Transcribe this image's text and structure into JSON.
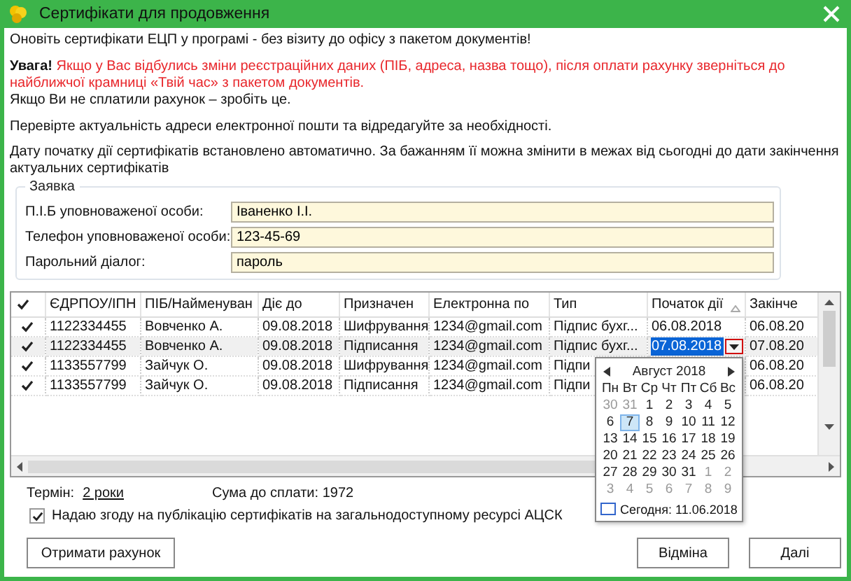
{
  "window": {
    "title": "Сертифікати для продовження"
  },
  "intro": "Оновіть сертифікати ЕЦП у програмі - без візиту до офісу з пакетом документів!",
  "warning": {
    "label": "Увага!",
    "text": "Якщо у Вас відбулись зміни реєстраційних даних (ПІБ, адреса, назва тощо), після оплати рахунку зверніться до найближчої крамниці «Твій час» з пакетом документів."
  },
  "note_unpaid": "Якщо Ви не сплатили рахунок – зробіть це.",
  "note_email": "Перевірте актуальність адреси електронної пошти та відредагуйте за необхідності.",
  "note_date": "Дату початку дії сертифікатів встановлено автоматично. За бажанням її можна змінити в межах від сьогодні до дати закінчення актуальних сертифікатів",
  "form": {
    "title": "Заявка",
    "fields": [
      {
        "label": "П.І.Б уповноваженої особи:",
        "value": "Іваненко І.І."
      },
      {
        "label": "Телефон уповноваженої особи:",
        "value": "123-45-69"
      },
      {
        "label": "Парольний діалог:",
        "value": "пароль"
      }
    ]
  },
  "table": {
    "all_checked": true,
    "columns": [
      {
        "label": "ЄДРПОУ/ІПН",
        "kind": "text",
        "sorted": false
      },
      {
        "label": "ПІБ/Найменуван",
        "kind": "text",
        "sorted": false
      },
      {
        "label": "Діє до",
        "kind": "text",
        "sorted": false
      },
      {
        "label": "Призначен",
        "kind": "text",
        "sorted": false
      },
      {
        "label": "Електронна по",
        "kind": "text",
        "sorted": false
      },
      {
        "label": "Тип",
        "kind": "text",
        "sorted": false
      },
      {
        "label": "Початок дії",
        "kind": "date_picker",
        "sorted": true
      },
      {
        "label": "Закінче",
        "kind": "text",
        "sorted": false
      }
    ],
    "rows": [
      {
        "checked": true,
        "selected": false,
        "cells": [
          "1122334455",
          "Вовченко А.",
          "09.08.2018",
          "Шифрування",
          "1234@gmail.com",
          "Підпис бухг...",
          "06.08.2018",
          "06.08.20"
        ]
      },
      {
        "checked": true,
        "selected": true,
        "cells": [
          "1122334455",
          "Вовченко А.",
          "09.08.2018",
          "Підписання",
          "1234@gmail.com",
          "Підпис бухг...",
          "07.08.2018",
          "07.08.20"
        ]
      },
      {
        "checked": true,
        "selected": false,
        "cells": [
          "1133557799",
          "Зайчук О.",
          "09.08.2018",
          "Шифрування",
          "1234@gmail.com",
          "Підпи",
          null,
          "06.08.20"
        ]
      },
      {
        "checked": true,
        "selected": false,
        "cells": [
          "1133557799",
          "Зайчук О.",
          "09.08.2018",
          "Підписання",
          "1234@gmail.com",
          "Підпи",
          null,
          "06.08.20"
        ]
      }
    ]
  },
  "calendar": {
    "month": "Август 2018",
    "weekdays": [
      "Пн",
      "Вт",
      "Ср",
      "Чт",
      "Пт",
      "Сб",
      "Вс"
    ],
    "weeks": [
      [
        {
          "day": "30",
          "other_month": true,
          "selected": false
        },
        {
          "day": "31",
          "other_month": true,
          "selected": false
        },
        {
          "day": "1",
          "other_month": false,
          "selected": false
        },
        {
          "day": "2",
          "other_month": false,
          "selected": false
        },
        {
          "day": "3",
          "other_month": false,
          "selected": false
        },
        {
          "day": "4",
          "other_month": false,
          "selected": false
        },
        {
          "day": "5",
          "other_month": false,
          "selected": false
        }
      ],
      [
        {
          "day": "6",
          "other_month": false,
          "selected": false
        },
        {
          "day": "7",
          "other_month": false,
          "selected": true
        },
        {
          "day": "8",
          "other_month": false,
          "selected": false
        },
        {
          "day": "9",
          "other_month": false,
          "selected": false
        },
        {
          "day": "10",
          "other_month": false,
          "selected": false
        },
        {
          "day": "11",
          "other_month": false,
          "selected": false
        },
        {
          "day": "12",
          "other_month": false,
          "selected": false
        }
      ],
      [
        {
          "day": "13",
          "other_month": false,
          "selected": false
        },
        {
          "day": "14",
          "other_month": false,
          "selected": false
        },
        {
          "day": "15",
          "other_month": false,
          "selected": false
        },
        {
          "day": "16",
          "other_month": false,
          "selected": false
        },
        {
          "day": "17",
          "other_month": false,
          "selected": false
        },
        {
          "day": "18",
          "other_month": false,
          "selected": false
        },
        {
          "day": "19",
          "other_month": false,
          "selected": false
        }
      ],
      [
        {
          "day": "20",
          "other_month": false,
          "selected": false
        },
        {
          "day": "21",
          "other_month": false,
          "selected": false
        },
        {
          "day": "22",
          "other_month": false,
          "selected": false
        },
        {
          "day": "23",
          "other_month": false,
          "selected": false
        },
        {
          "day": "24",
          "other_month": false,
          "selected": false
        },
        {
          "day": "25",
          "other_month": false,
          "selected": false
        },
        {
          "day": "26",
          "other_month": false,
          "selected": false
        }
      ],
      [
        {
          "day": "27",
          "other_month": false,
          "selected": false
        },
        {
          "day": "28",
          "other_month": false,
          "selected": false
        },
        {
          "day": "29",
          "other_month": false,
          "selected": false
        },
        {
          "day": "30",
          "other_month": false,
          "selected": false
        },
        {
          "day": "31",
          "other_month": false,
          "selected": false
        },
        {
          "day": "1",
          "other_month": true,
          "selected": false
        },
        {
          "day": "2",
          "other_month": true,
          "selected": false
        }
      ],
      [
        {
          "day": "3",
          "other_month": true,
          "selected": false
        },
        {
          "day": "4",
          "other_month": true,
          "selected": false
        },
        {
          "day": "5",
          "other_month": true,
          "selected": false
        },
        {
          "day": "6",
          "other_month": true,
          "selected": false
        },
        {
          "day": "7",
          "other_month": true,
          "selected": false
        },
        {
          "day": "8",
          "other_month": true,
          "selected": false
        },
        {
          "day": "9",
          "other_month": true,
          "selected": false
        }
      ]
    ],
    "today": "Сегодня: 11.06.2018"
  },
  "term": {
    "label": "Термін:",
    "value": "2 роки"
  },
  "sum": "Сума до сплати: 1972",
  "consent": {
    "text": "Надаю згоду на публікацію сертифікатів на загальнодоступному ресурсі АЦСК",
    "checked": true
  },
  "buttons": [
    {
      "label": "Отримати рахунок",
      "kind": "left"
    },
    {
      "label": "Відміна",
      "kind": "right"
    },
    {
      "label": "Далі",
      "kind": "right"
    }
  ]
}
